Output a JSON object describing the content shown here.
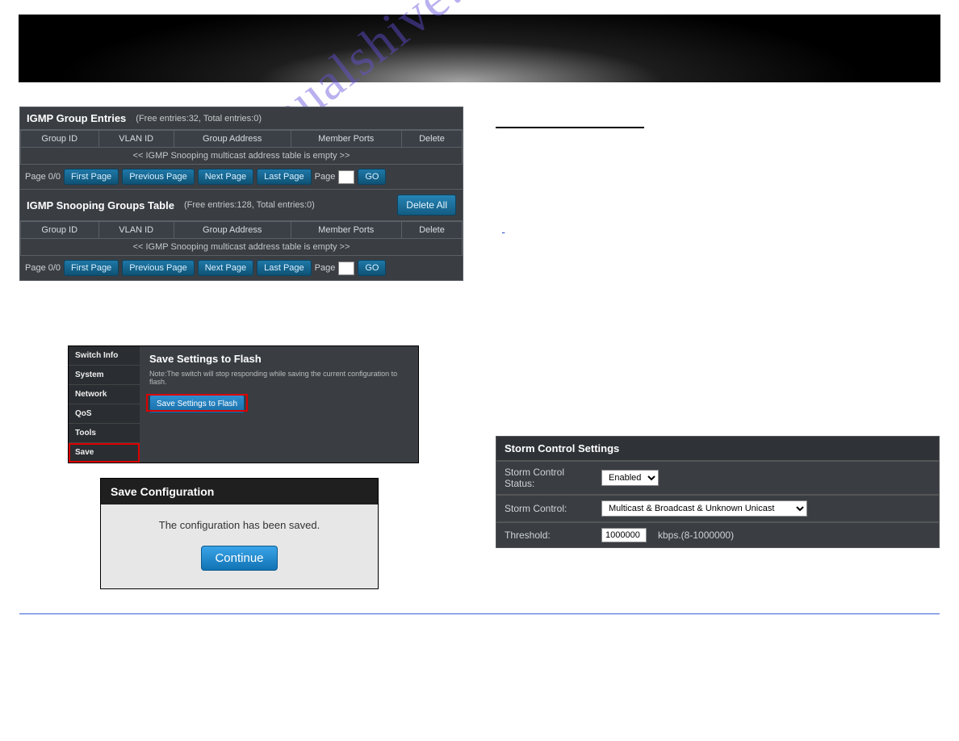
{
  "watermark": "manualshive.com",
  "igmp_group": {
    "title": "IGMP Group Entries",
    "stats": "(Free entries:32, Total entries:0)",
    "cols": [
      "Group ID",
      "VLAN ID",
      "Group Address",
      "Member Ports",
      "Delete"
    ],
    "empty": "<< IGMP Snooping multicast address table is empty >>"
  },
  "igmp_snoop": {
    "title": "IGMP Snooping Groups Table",
    "stats": "(Free entries:128, Total entries:0)",
    "delete_all": "Delete All",
    "cols": [
      "Group ID",
      "VLAN ID",
      "Group Address",
      "Member Ports",
      "Delete"
    ],
    "empty": "<< IGMP Snooping multicast address table is empty >>"
  },
  "pager": {
    "page": "Page 0/0",
    "first": "First Page",
    "prev": "Previous Page",
    "next": "Next Page",
    "last": "Last Page",
    "page_lbl": "Page",
    "go": "GO"
  },
  "save_nav": [
    "Switch Info",
    "System",
    "Network",
    "QoS",
    "Tools",
    "Save"
  ],
  "save_settings": {
    "title": "Save Settings to Flash",
    "note": "Note:The switch will stop responding while saving the current configuration to flash.",
    "button": "Save Settings to Flash"
  },
  "save_config": {
    "title": "Save Configuration",
    "msg": "The configuration has been saved.",
    "continue": "Continue"
  },
  "storm": {
    "hdr": "Storm Control Settings",
    "status_lbl": "Storm Control Status:",
    "status_val": "Enabled",
    "control_lbl": "Storm Control:",
    "control_val": "Multicast & Broadcast & Unknown Unicast",
    "thresh_lbl": "Threshold:",
    "thresh_val": "1000000",
    "thresh_unit": "kbps.(8-1000000)"
  }
}
